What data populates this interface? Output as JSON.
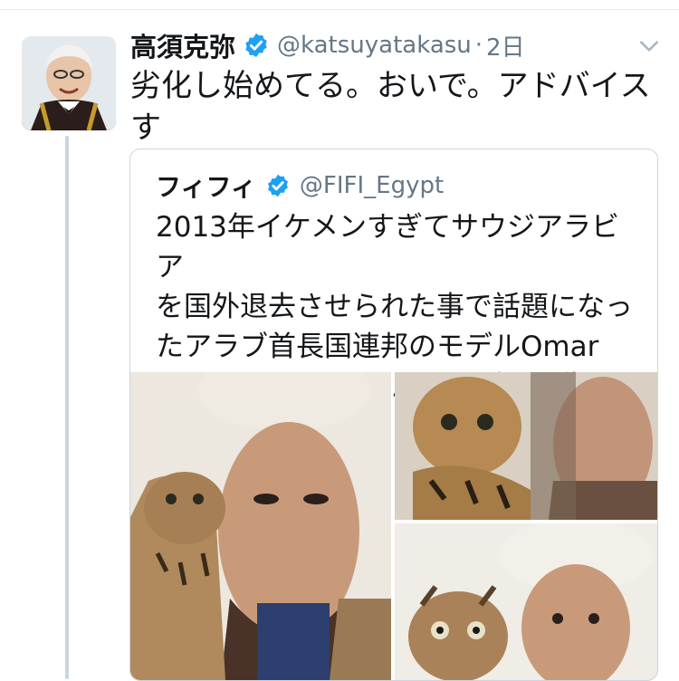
{
  "tweet": {
    "author_name": "高須克弥",
    "handle": "@katsuyatakasu",
    "separator": "·",
    "time": "2日",
    "text": "劣化し始めてる。おいで。アドバイスす\nる。",
    "icons": {
      "verified": "verified-badge-icon",
      "menu": "chevron-down-icon"
    },
    "accent_color": "#1da1f2"
  },
  "quoted_tweet": {
    "author_name": "フィフィ",
    "handle": "@FIFI_Egypt",
    "text": "2013年イケメンすぎてサウジアラビア\nを国外退去させられた事で話題になっ\nたアラブ首長国連邦のモデルOmar\nBorkan Al Galaさんの最近の画像",
    "media_count": 3
  }
}
